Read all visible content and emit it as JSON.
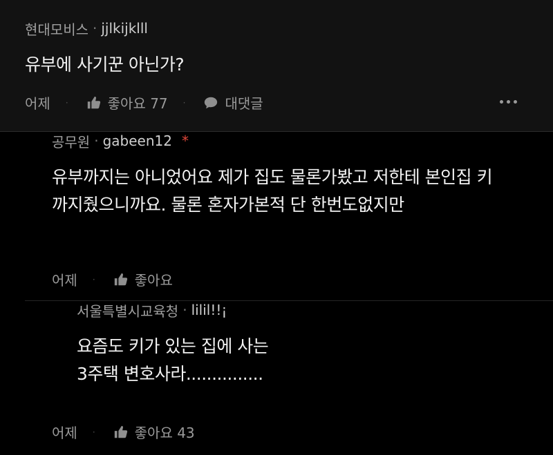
{
  "comments": [
    {
      "org": "현대모비스",
      "nick": "jjlkijklll",
      "text": "유부에 사기꾼 아닌가?",
      "time": "어제",
      "like_label": "좋아요 77",
      "reply_label": "대댓글"
    }
  ],
  "replies": [
    {
      "org": "공무원",
      "nick": "gabeen12",
      "author_mark": "*",
      "text": "유부까지는 아니었어요 제가 집도 물론가봤고 저한테 본인집 키\n까지줬으니까요. 물론 혼자가본적 단 한번도없지만",
      "time": "어제",
      "like_label": "좋아요"
    },
    {
      "org": "서울특별시교육청",
      "nick": "lilil!!¡",
      "text": "요즘도 키가 있는 집에 사는\n3주택 변호사라...............",
      "time": "어제",
      "like_label": "좋아요 43"
    }
  ],
  "separator": "·",
  "icons": {
    "like": "thumbs-up-icon",
    "reply": "speech-bubble-icon",
    "more": "more-dots-icon"
  },
  "colors": {
    "background": "#000000",
    "author_mark": "#e0473a"
  }
}
